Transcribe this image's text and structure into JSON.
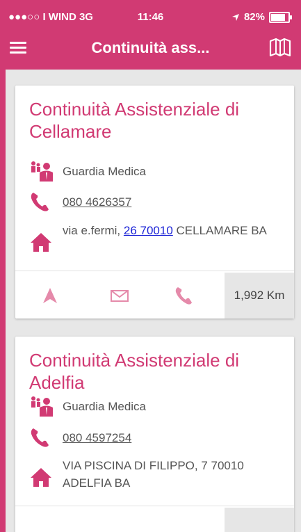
{
  "status_bar": {
    "carrier": "●●●○○ I WIND  3G",
    "time": "11:46",
    "battery": "82%"
  },
  "nav": {
    "title": "Continuità ass...",
    "menu_icon": "hamburger-icon",
    "map_icon": "map-icon"
  },
  "cards": [
    {
      "title": "Continuità Assistenziale di Cellamare",
      "type": "Guardia Medica",
      "phone": "080 4626357",
      "address_prefix": "via e.fermi,",
      "address_link": "26 70010",
      "address_suffix": "CELLAMARE BA",
      "distance": "1,992 Km"
    },
    {
      "title": "Continuità Assistenziale di Adelfia",
      "type": "Guardia Medica",
      "phone": "080 4597254",
      "address_full": "VIA PISCINA DI FILIPPO, 7 70010 ADELFIA BA"
    }
  ],
  "colors": {
    "accent": "#d13a73",
    "accent_light": "#e58aaa",
    "link": "#1a22d6"
  }
}
